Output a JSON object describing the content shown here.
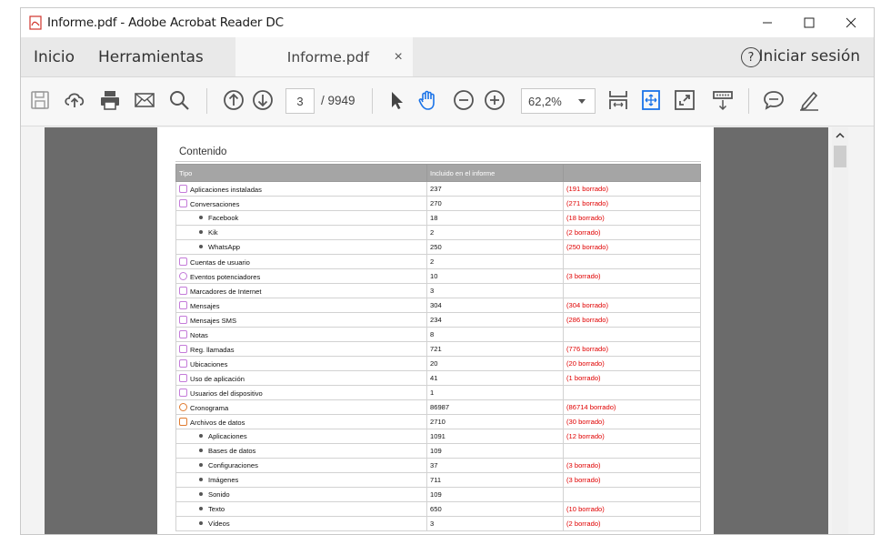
{
  "window": {
    "title": "Informe.pdf - Adobe Acrobat Reader DC"
  },
  "menu": {
    "home": "Inicio",
    "tools": "Herramientas",
    "tab_label": "Informe.pdf",
    "tab_close": "×",
    "help": "?",
    "signin": "Iniciar sesión"
  },
  "toolbar": {
    "current_page": "3",
    "total_pages": "/ 9949",
    "zoom": "62,2%"
  },
  "report": {
    "section_title": "Contenido",
    "headers": [
      "Tipo",
      "Incluido en el informe",
      ""
    ],
    "rows": [
      {
        "label": "Aplicaciones instaladas",
        "value": "237",
        "deleted": "(191 borrado)",
        "icon": "apps-icon",
        "sub": false
      },
      {
        "label": "Conversaciones",
        "value": "270",
        "deleted": "(271 borrado)",
        "icon": "chat-icon",
        "sub": false
      },
      {
        "label": "Facebook",
        "value": "18",
        "deleted": "(18 borrado)",
        "icon": "",
        "sub": true
      },
      {
        "label": "Kik",
        "value": "2",
        "deleted": "(2 borrado)",
        "icon": "",
        "sub": true
      },
      {
        "label": "WhatsApp",
        "value": "250",
        "deleted": "(250 borrado)",
        "icon": "",
        "sub": true
      },
      {
        "label": "Cuentas de usuario",
        "value": "2",
        "deleted": "",
        "icon": "user-account-icon",
        "sub": false
      },
      {
        "label": "Eventos potenciadores",
        "value": "10",
        "deleted": "(3 borrado)",
        "icon": "power-icon",
        "sub": false
      },
      {
        "label": "Marcadores de Internet",
        "value": "3",
        "deleted": "",
        "icon": "bookmark-icon",
        "sub": false
      },
      {
        "label": "Mensajes",
        "value": "304",
        "deleted": "(304 borrado)",
        "icon": "mail-icon",
        "sub": false
      },
      {
        "label": "Mensajes SMS",
        "value": "234",
        "deleted": "(286 borrado)",
        "icon": "sms-icon",
        "sub": false
      },
      {
        "label": "Notas",
        "value": "8",
        "deleted": "",
        "icon": "notes-icon",
        "sub": false
      },
      {
        "label": "Reg. llamadas",
        "value": "721",
        "deleted": "(776 borrado)",
        "icon": "phone-icon",
        "sub": false
      },
      {
        "label": "Ubicaciones",
        "value": "20",
        "deleted": "(20 borrado)",
        "icon": "location-icon",
        "sub": false
      },
      {
        "label": "Uso de aplicación",
        "value": "41",
        "deleted": "(1 borrado)",
        "icon": "app-usage-icon",
        "sub": false
      },
      {
        "label": "Usuarios del dispositivo",
        "value": "1",
        "deleted": "",
        "icon": "users-icon",
        "sub": false
      },
      {
        "label": "Cronograma",
        "value": "86987",
        "deleted": "(86714 borrado)",
        "icon": "clock-icon",
        "sub": false
      },
      {
        "label": "Archivos de datos",
        "value": "2710",
        "deleted": "(30 borrado)",
        "icon": "data-files-icon",
        "sub": false
      },
      {
        "label": "Aplicaciones",
        "value": "1091",
        "deleted": "(12 borrado)",
        "icon": "",
        "sub": true
      },
      {
        "label": "Bases de datos",
        "value": "109",
        "deleted": "",
        "icon": "",
        "sub": true
      },
      {
        "label": "Configuraciones",
        "value": "37",
        "deleted": "(3 borrado)",
        "icon": "",
        "sub": true
      },
      {
        "label": "Imágenes",
        "value": "711",
        "deleted": "(3 borrado)",
        "icon": "",
        "sub": true
      },
      {
        "label": "Sonido",
        "value": "109",
        "deleted": "",
        "icon": "",
        "sub": true
      },
      {
        "label": "Texto",
        "value": "650",
        "deleted": "(10 borrado)",
        "icon": "",
        "sub": true
      },
      {
        "label": "Vídeos",
        "value": "3",
        "deleted": "(2 borrado)",
        "icon": "",
        "sub": true
      }
    ]
  },
  "colors": {
    "deleted": "#e00000",
    "icon_purple": "#c47bd9",
    "icon_orange": "#e07b30",
    "header_gray": "#a5a5a5"
  }
}
